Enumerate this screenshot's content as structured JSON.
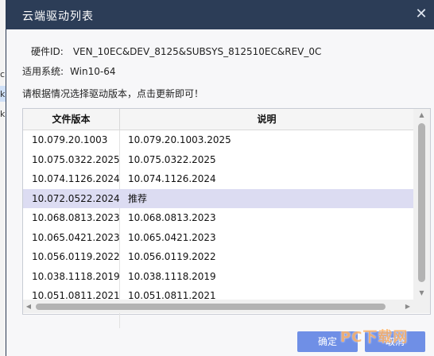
{
  "dialog": {
    "title": "云端驱动列表"
  },
  "hardware": {
    "label": "硬件ID:",
    "value": "VEN_10EC&DEV_8125&SUBSYS_812510EC&REV_0C"
  },
  "os": {
    "label": "适用系统:",
    "value": "Win10-64"
  },
  "hint": "请根据情况选择驱动版本，点击更新即可！",
  "table": {
    "columns": [
      "文件版本",
      "说明"
    ],
    "rows": [
      {
        "version": "10.079.20.1003",
        "desc": "10.079.20.1003.2025"
      },
      {
        "version": "10.075.0322.2025",
        "desc": "10.075.0322.2025"
      },
      {
        "version": "10.074.1126.2024",
        "desc": "10.074.1126.2024"
      },
      {
        "version": "10.072.0522.2024",
        "desc": "推荐"
      },
      {
        "version": "10.068.0813.2023",
        "desc": "10.068.0813.2023"
      },
      {
        "version": "10.065.0421.2023",
        "desc": "10.065.0421.2023"
      },
      {
        "version": "10.056.0119.2022",
        "desc": "10.056.0119.2022"
      },
      {
        "version": "10.038.1118.2019",
        "desc": "10.038.1118.2019"
      },
      {
        "version": "10.051.0811.2021",
        "desc": "10.051.0811.2021"
      }
    ],
    "selected_index": 3
  },
  "buttons": {
    "ok": "确定",
    "cancel": "取消"
  },
  "watermark": "PC下载网",
  "background_letters": [
    "c",
    "k",
    "k"
  ]
}
